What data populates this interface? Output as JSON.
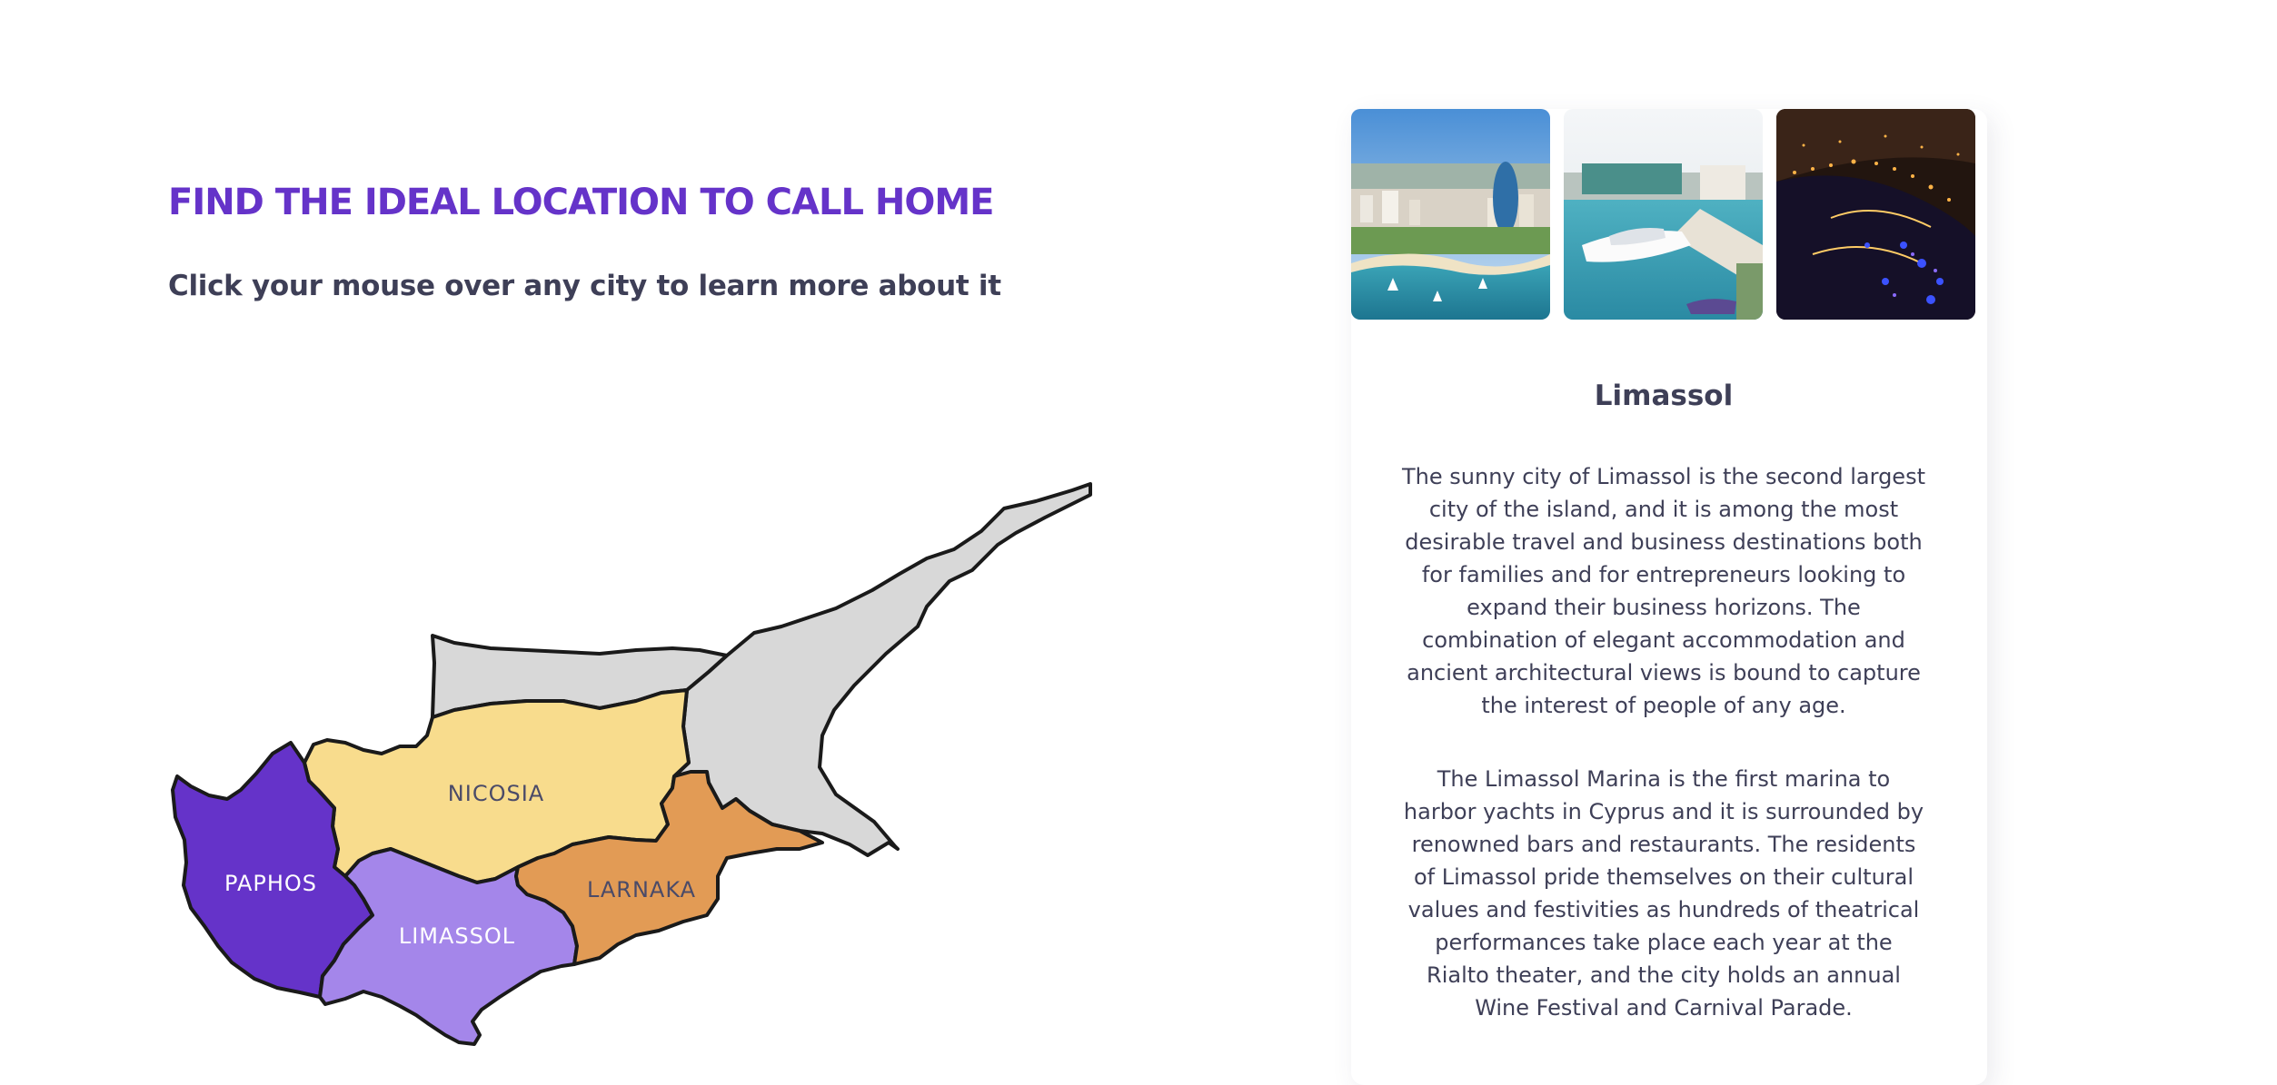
{
  "header": {
    "title": "FIND THE IDEAL LOCATION TO CALL HOME",
    "subtitle": "Click your mouse over any city to learn more about it"
  },
  "map": {
    "regions": [
      {
        "id": "nicosia",
        "label": "NICOSIA",
        "color": "#f8dc8d"
      },
      {
        "id": "paphos",
        "label": "PAPHOS",
        "color": "#6533c9"
      },
      {
        "id": "limassol",
        "label": "LIMASSOL",
        "color": "#a486ea"
      },
      {
        "id": "larnaka",
        "label": "LARNAKA",
        "color": "#e29b55"
      },
      {
        "id": "famagusta-north",
        "label": "",
        "color": "#d8d8d8"
      }
    ]
  },
  "city": {
    "name": "Limassol",
    "photos": [
      "coastal-city-photo",
      "marina-yacht-photo",
      "night-marina-photo"
    ],
    "paragraphs": [
      "The sunny city of Limassol is the second largest city of the island, and it is among the most desirable travel and business destinations both for families and for entrepreneurs looking to expand their business horizons. The combination of elegant accommodation and ancient architectural views is bound to capture the interest of people of any age.",
      "The Limassol Marina is the first marina to harbor yachts in Cyprus and it is surrounded by renowned bars and restaurants. The residents of Limassol pride themselves on their cultural values and festivities as hundreds of theatrical performances take place each year at the Rialto theater, and the city holds an annual Wine Festival and Carnival Parade."
    ]
  },
  "colors": {
    "accent": "#6533c9",
    "text": "#3e3f57"
  }
}
